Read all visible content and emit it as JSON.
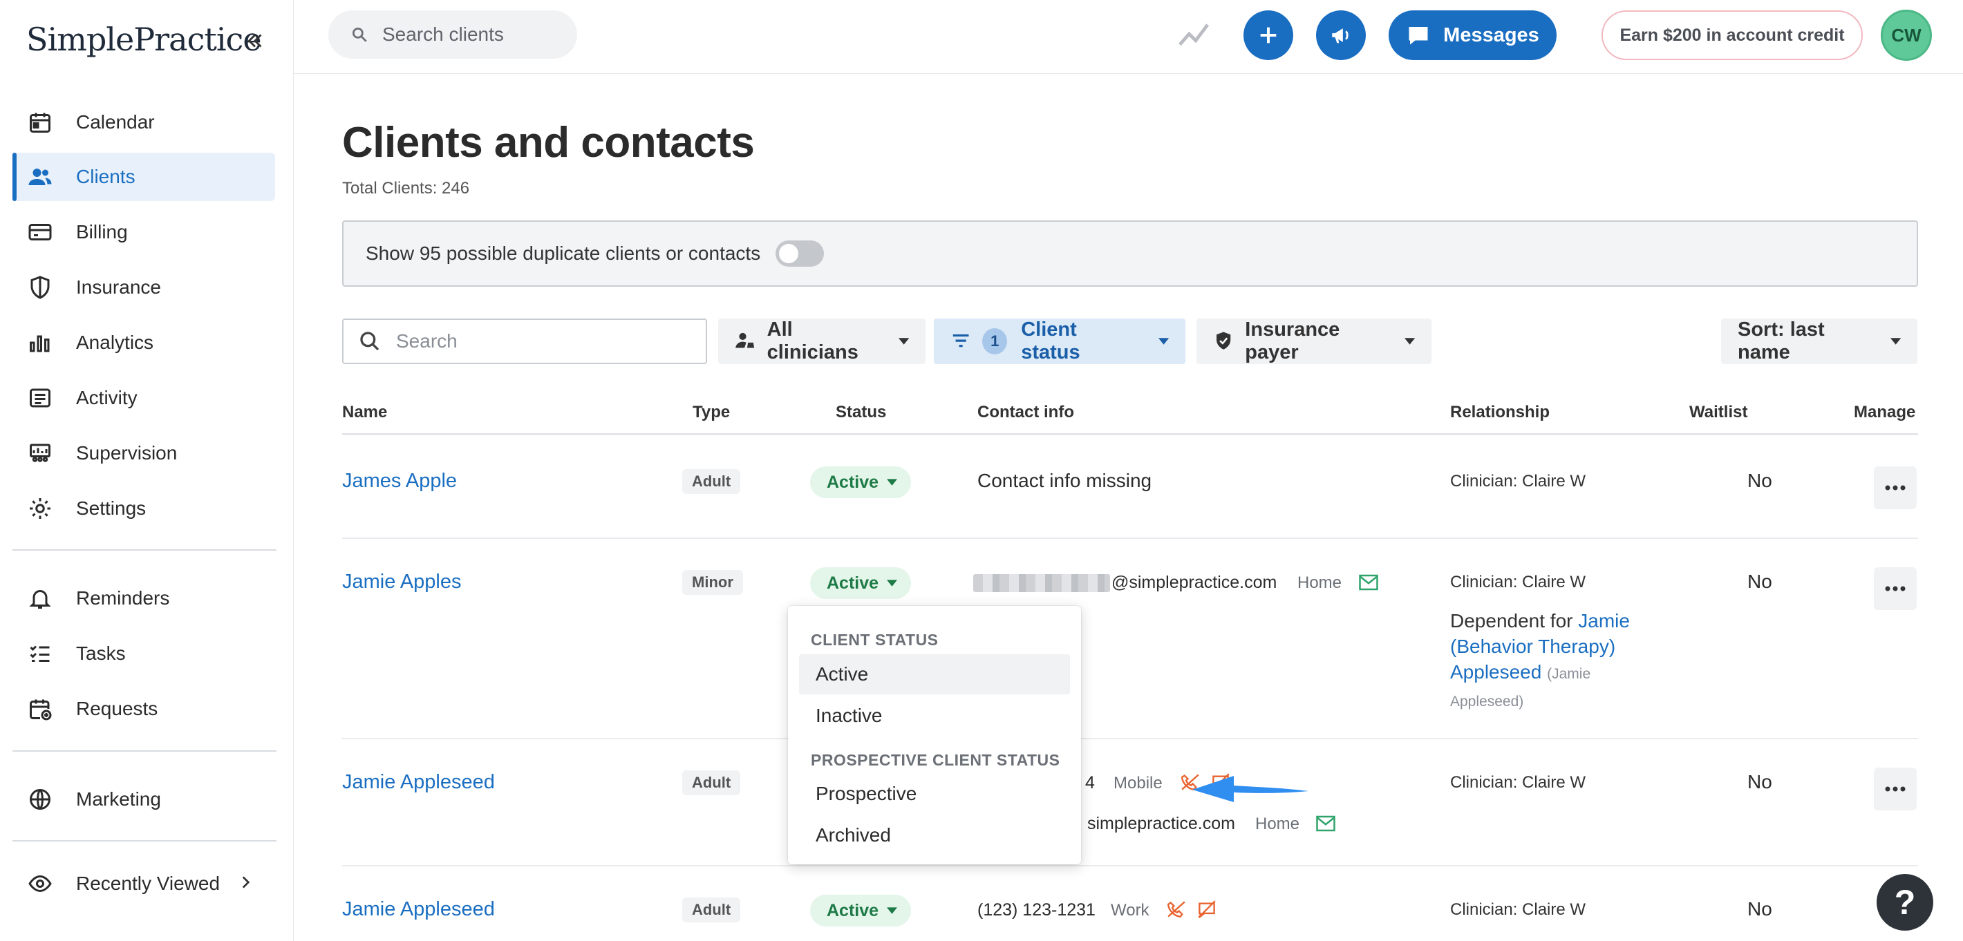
{
  "brand": {
    "logo_text": "SimplePractice"
  },
  "sidebar": {
    "items": [
      {
        "label": "Calendar",
        "icon": "calendar-icon"
      },
      {
        "label": "Clients",
        "icon": "users-icon",
        "active": true
      },
      {
        "label": "Billing",
        "icon": "credit-card-icon"
      },
      {
        "label": "Insurance",
        "icon": "shield-icon"
      },
      {
        "label": "Analytics",
        "icon": "bar-chart-icon"
      },
      {
        "label": "Activity",
        "icon": "list-icon"
      },
      {
        "label": "Supervision",
        "icon": "supervision-icon"
      },
      {
        "label": "Settings",
        "icon": "gear-icon"
      }
    ],
    "secondary": [
      {
        "label": "Reminders",
        "icon": "bell-icon"
      },
      {
        "label": "Tasks",
        "icon": "checklist-icon"
      },
      {
        "label": "Requests",
        "icon": "calendar-plus-icon"
      }
    ],
    "marketing": {
      "label": "Marketing",
      "icon": "globe-icon"
    },
    "recently_viewed": {
      "label": "Recently Viewed",
      "icon": "eye-icon"
    }
  },
  "topbar": {
    "search_placeholder": "Search clients",
    "messages_label": "Messages",
    "earn_label": "Earn $200 in account credit",
    "avatar_initials": "CW"
  },
  "page": {
    "title": "Clients and contacts",
    "total": "Total Clients: 246",
    "duplicate_text": "Show 95 possible duplicate clients or contacts"
  },
  "filters": {
    "search_placeholder": "Search",
    "clinicians": "All clinicians",
    "status_count": "1",
    "status": "Client status",
    "insurance": "Insurance payer",
    "sort": "Sort: last name"
  },
  "table": {
    "headers": [
      "Name",
      "Type",
      "Status",
      "Contact info",
      "Relationship",
      "Waitlist",
      "Manage"
    ],
    "rows": [
      {
        "name": "James Apple",
        "type": "Adult",
        "status": "Active",
        "contact": "Contact info missing",
        "relationship": "Clinician: Claire W",
        "waitlist": "No"
      },
      {
        "name": "Jamie Apples",
        "type": "Minor",
        "status": "Active",
        "email_domain": "@simplepractice.com",
        "email_tag": "Home",
        "relationship": "Clinician: Claire W",
        "dep_prefix": "Dependent for ",
        "dep_link": "Jamie (Behavior Therapy) Appleseed",
        "dep_sub": "(Jamie Appleseed)",
        "waitlist": "No"
      },
      {
        "name": "Jamie Appleseed",
        "type": "Adult",
        "phone_suffix": "4",
        "phone_tag": "Mobile",
        "email_domain": "simplepractice.com",
        "email_tag": "Home",
        "relationship": "Clinician: Claire W",
        "waitlist": "No"
      },
      {
        "name": "Jamie Appleseed",
        "type": "Adult",
        "status": "Active",
        "phone": "(123) 123-1231",
        "phone_tag": "Work",
        "relationship": "Clinician: Claire W",
        "waitlist": "No"
      }
    ]
  },
  "dropdown": {
    "heading1": "CLIENT STATUS",
    "active": "Active",
    "inactive": "Inactive",
    "heading2": "PROSPECTIVE CLIENT STATUS",
    "prospective": "Prospective",
    "archived": "Archived"
  },
  "help_label": "?",
  "colors": {
    "accent": "#1a6ec1",
    "status_green": "#1e7a46",
    "arrow": "#2f8ef0"
  }
}
